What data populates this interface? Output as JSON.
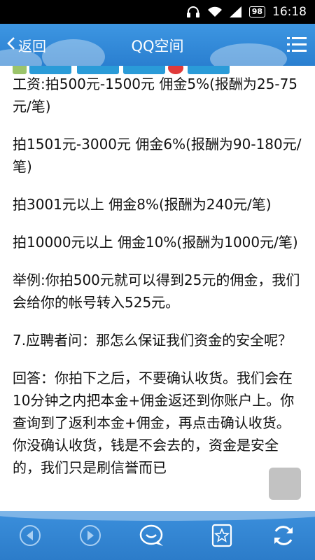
{
  "status_bar": {
    "battery": "98",
    "time": "16:18"
  },
  "header": {
    "back_label": "返回",
    "title": "QQ空间"
  },
  "article": {
    "paragraphs": [
      "工资:拍500元-1500元 佣金5%(报酬为25-75元/笔)",
      "拍1501元-3000元 佣金6%(报酬为90-180元/笔)",
      "拍3001元以上 佣金8%(报酬为240元/笔)",
      "拍10000元以上 佣金10%(报酬为1000元/笔)",
      "举例:你拍500元就可以得到25元的佣金，我们会给你的帐号转入525元。",
      "7.应聘者问：那怎么保证我们资金的安全呢？",
      "回答：你拍下之后，不要确认收货。我们会在10分钟之内把本金+佣金返还到你账户上。你查询到了返利本金+佣金，再点击确认收货。你没确认收货，钱是不会去的，资金是安全的，我们只是刷信誉而已"
    ]
  },
  "toolbar": {
    "icons": [
      "back-arrow-icon",
      "forward-arrow-icon",
      "chat-bubble-icon",
      "bookmark-star-icon",
      "refresh-icon"
    ]
  },
  "colors": {
    "header_blue": "#2f86d6",
    "text": "#111111"
  }
}
